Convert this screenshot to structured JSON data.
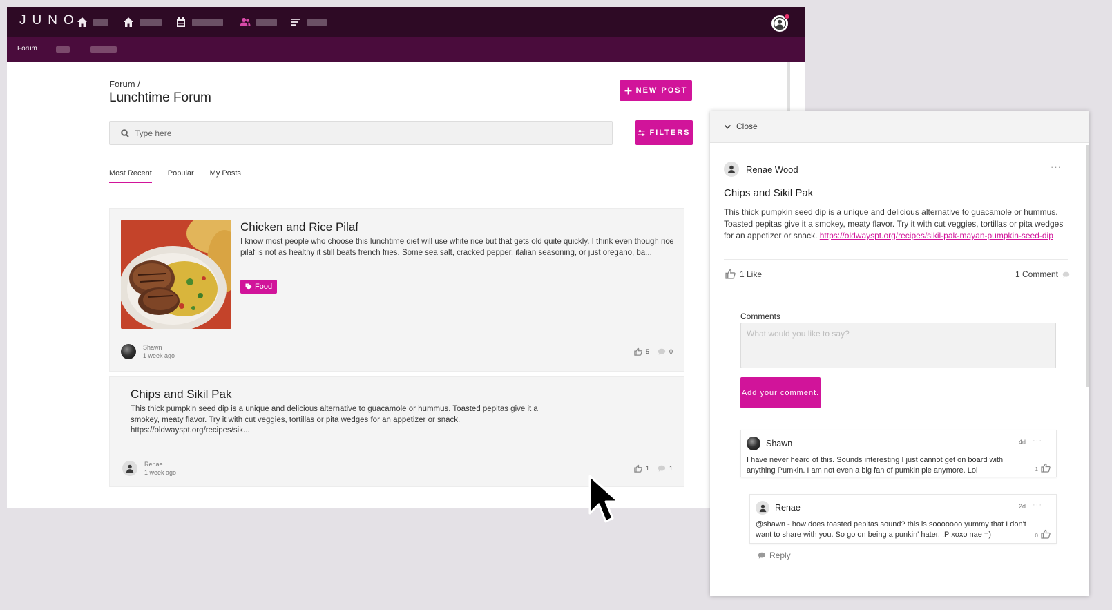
{
  "nav": {
    "logo": "JUNO",
    "notification_color": "#e8336d"
  },
  "subnav": {
    "forum": "Forum"
  },
  "page": {
    "breadcrumb_link": "Forum",
    "breadcrumb_sep": "/",
    "title": "Lunchtime Forum",
    "new_post_label": "NEW POST",
    "filters_label": "FILTERS",
    "search_placeholder": "Type here",
    "tabs": [
      "Most Recent",
      "Popular",
      "My Posts"
    ],
    "accent_color": "#d1149a"
  },
  "posts": [
    {
      "title": "Chicken and Rice Pilaf",
      "body": "I know most people who choose this lunchtime diet will use white rice but that gets old quite quickly. I think even though rice pilaf is not as healthy it still beats french fries. Some sea salt, cracked pepper, italian seasoning, or just oregano, ba...",
      "tag": "Food",
      "author": "Shawn",
      "time": "1 week ago",
      "likes": "5",
      "comments": "0"
    },
    {
      "title": "Chips and Sikil Pak",
      "body": "This thick pumpkin seed dip is a unique and delicious alternative to guacamole or hummus. Toasted pepitas give it a smokey, meaty flavor. Try it with cut veggies, tortillas or pita wedges for an appetizer or snack. https://oldwayspt.org/recipes/sik...",
      "author": "Renae",
      "time": "1 week ago",
      "likes": "1",
      "comments": "1"
    }
  ],
  "drawer": {
    "close_label": "Close",
    "author": "Renae Wood",
    "more": "···",
    "title": "Chips and Sikil Pak",
    "body": "This thick pumpkin seed dip is a unique and delicious alternative to guacamole or hummus. Toasted pepitas give it a smokey, meaty flavor. Try it with cut veggies, tortillas or pita wedges for an appetizer or snack.",
    "link": "https://oldwayspt.org/recipes/sikil-pak-mayan-pumpkin-seed-dip",
    "likes_label": "1 Like",
    "comments_label": "1 Comment",
    "comments_heading": "Comments",
    "comment_placeholder": "What would you like to say?",
    "add_comment_label": "Add your comment.",
    "comments": [
      {
        "author": "Shawn",
        "time": "4d",
        "text": "I have never heard of this. Sounds interesting I just cannot get on board with anything Pumkin. I am not even a big fan of pumkin pie anymore. Lol",
        "likes": "1"
      },
      {
        "author": "Renae",
        "time": "2d",
        "text": "@shawn - how does toasted pepitas sound? this is sooooooo yummy that I don't want to share with you. So go on being a punkin' hater. :P xoxo nae =)",
        "likes": "0"
      }
    ],
    "reply_label": "Reply"
  }
}
